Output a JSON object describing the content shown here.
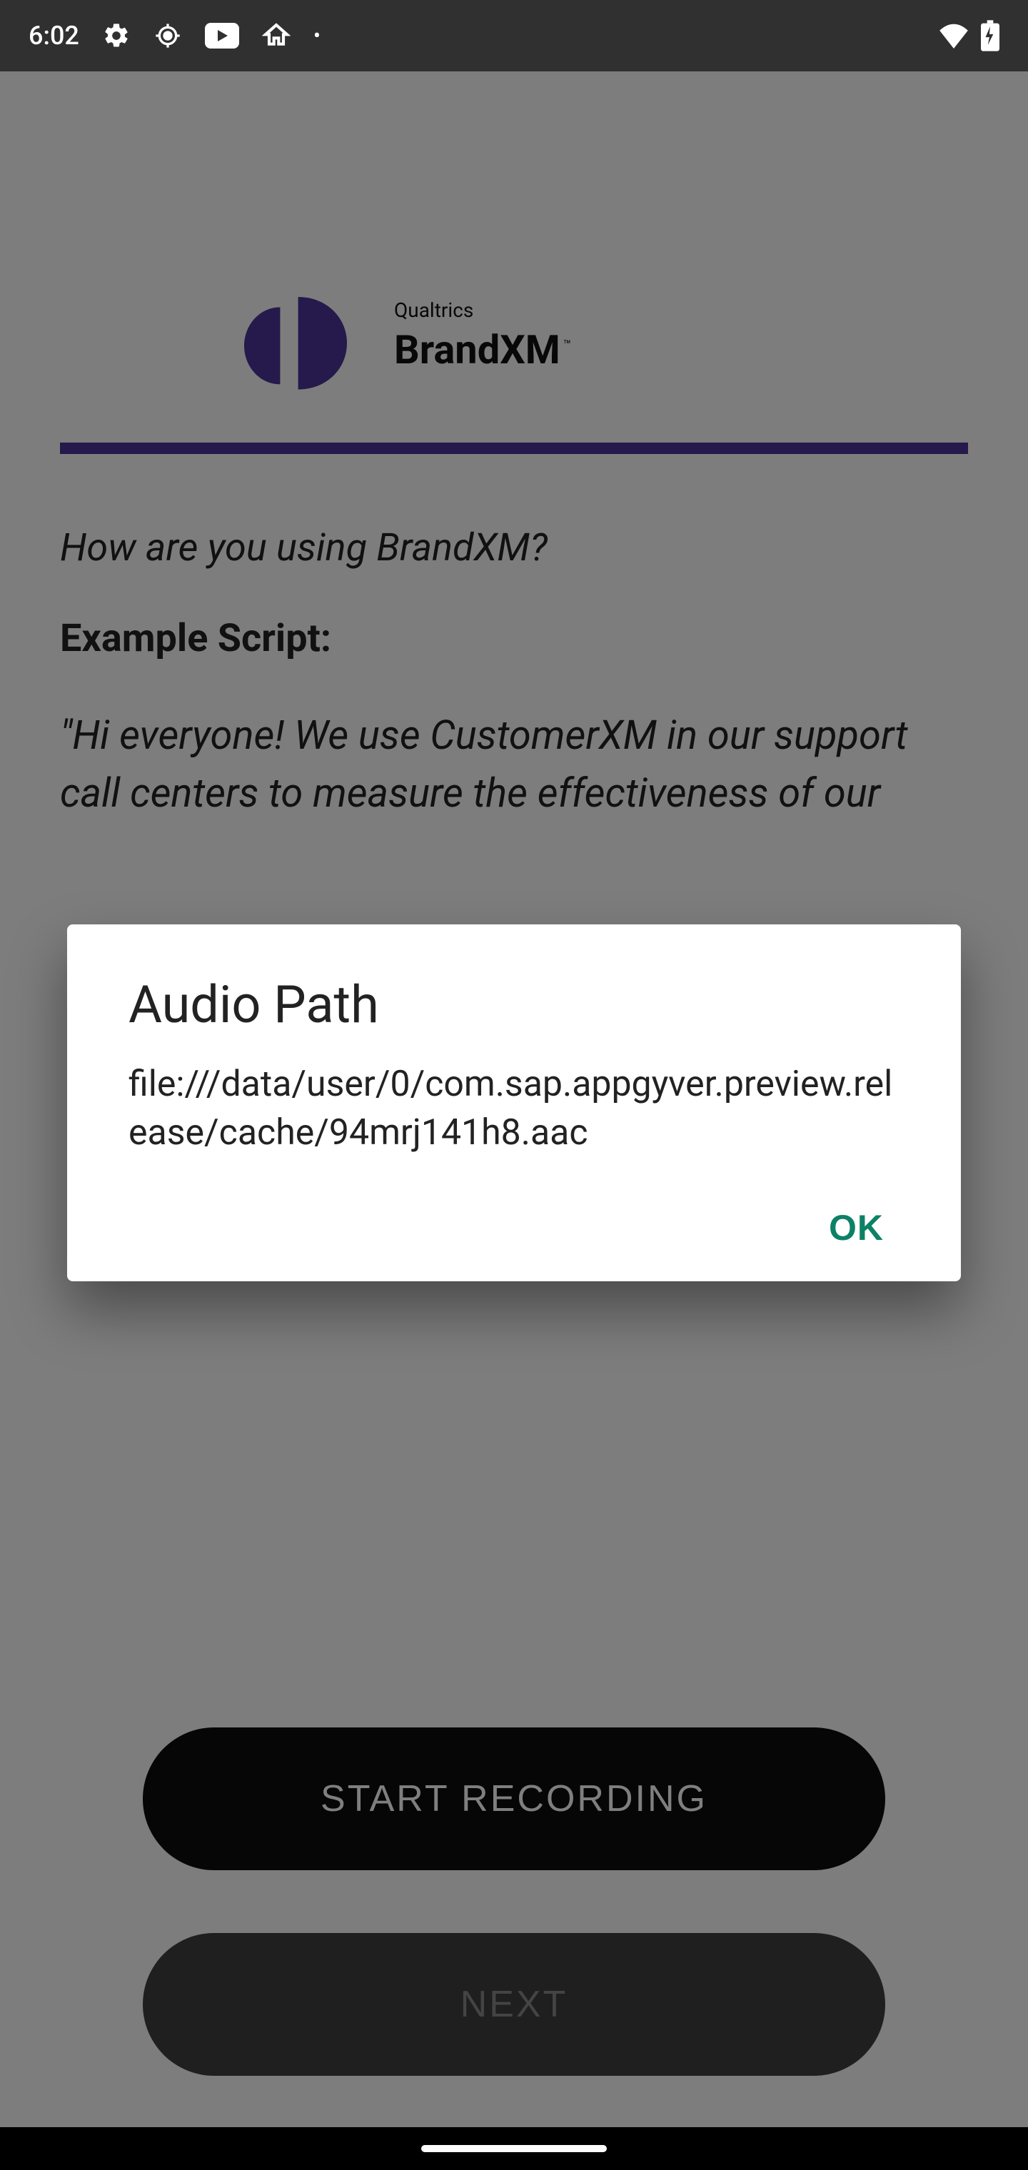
{
  "status": {
    "time": "6:02"
  },
  "logo": {
    "line1": "Qualtrics",
    "line2": "BrandXM",
    "tm": "™"
  },
  "content": {
    "question": "How are you using BrandXM?",
    "subhead": "Example Script:",
    "script": "\"Hi everyone! We use CustomerXM in our support call centers to measure the effectiveness of our"
  },
  "buttons": {
    "primary": "START RECORDING",
    "secondary": "NEXT"
  },
  "dialog": {
    "title": "Audio Path",
    "body": "file:///data/user/0/com.sap.appgyver.preview.release/cache/94mrj141h8.aac",
    "ok": "OK"
  }
}
